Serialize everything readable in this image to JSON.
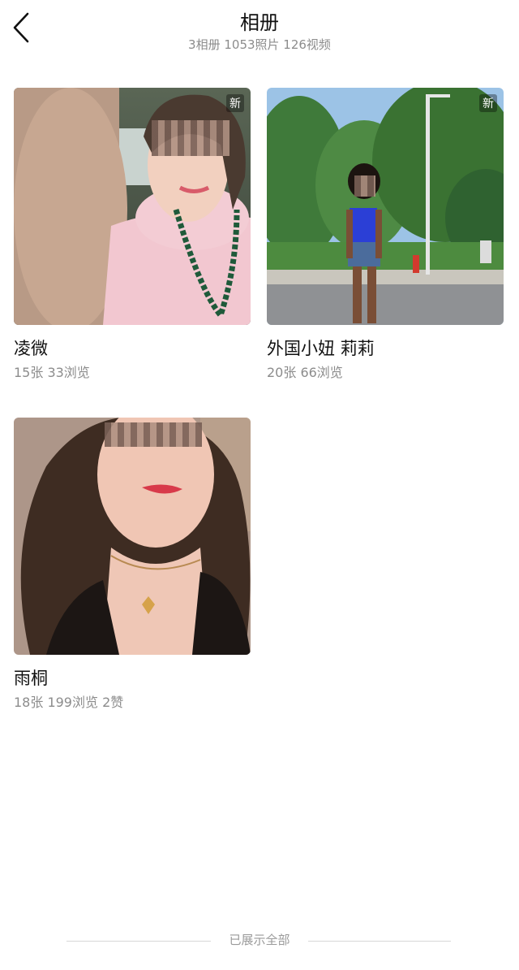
{
  "header": {
    "title": "相册",
    "subtitle": "3相册  1053照片  126视频"
  },
  "albums": [
    {
      "name": "凌微",
      "meta": "15张  33浏览",
      "badge": "新"
    },
    {
      "name": "外国小妞  莉莉",
      "meta": "20张  66浏览",
      "badge": "新"
    },
    {
      "name": "雨桐",
      "meta": "18张  199浏览  2赞",
      "badge": ""
    }
  ],
  "footer": {
    "text": "已展示全部"
  },
  "colors": {
    "muted_text": "#8c8c8c",
    "title_text": "#111111",
    "divider": "#d6d6d6"
  },
  "icons": {
    "back": "chevron-left-icon"
  }
}
